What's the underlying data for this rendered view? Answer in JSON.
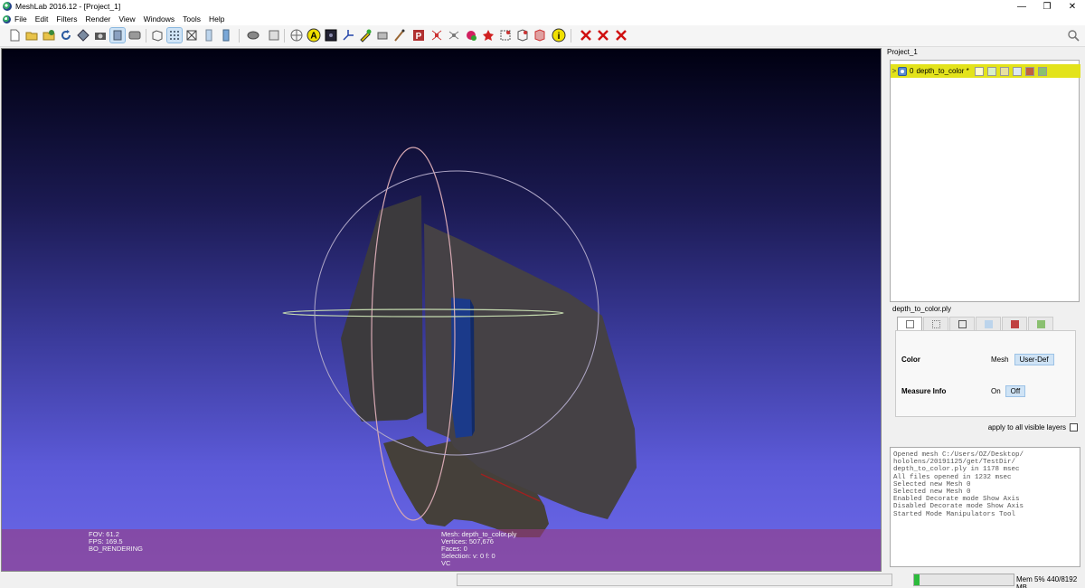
{
  "window": {
    "title": "MeshLab 2016.12 - [Project_1]",
    "controls": [
      "—",
      "❐",
      "✕"
    ]
  },
  "menu": [
    "File",
    "Edit",
    "Filters",
    "Render",
    "View",
    "Windows",
    "Tools",
    "Help"
  ],
  "toolbar": {
    "buttons": [
      {
        "name": "new-project-button",
        "icon": "new-document"
      },
      {
        "name": "open-project-button",
        "icon": "folder-open"
      },
      {
        "name": "import-mesh-button",
        "icon": "folder-add"
      },
      {
        "name": "reload-button",
        "icon": "reload"
      },
      {
        "name": "save-button",
        "icon": "save-diamond"
      },
      {
        "name": "snapshot-button",
        "icon": "camera"
      },
      {
        "name": "view-layers-button",
        "icon": "layers",
        "active": true
      },
      {
        "name": "raster-layers-button",
        "icon": "raster"
      },
      {
        "name": "bbox-render-button",
        "icon": "bounding-box"
      },
      {
        "name": "points-render-button",
        "icon": "points",
        "active": true
      },
      {
        "name": "wireframe-render-button",
        "icon": "wireframe"
      },
      {
        "name": "flat-render-button",
        "icon": "flat"
      },
      {
        "name": "smooth-render-button",
        "icon": "smooth"
      },
      {
        "name": "lighting-button",
        "icon": "light"
      },
      {
        "name": "trackball-button",
        "icon": "trackball"
      },
      {
        "name": "annotation-button",
        "icon": "A"
      },
      {
        "name": "info-tool-button",
        "icon": "info-dark"
      },
      {
        "name": "axis-button",
        "icon": "axis"
      },
      {
        "name": "measure-button",
        "icon": "pencil"
      },
      {
        "name": "paint-button",
        "icon": "brush"
      },
      {
        "name": "pickpoints-button",
        "icon": "pick"
      },
      {
        "name": "image-align-button",
        "icon": "image"
      },
      {
        "name": "align-button",
        "icon": "align"
      },
      {
        "name": "fill-hole-button",
        "icon": "fill"
      },
      {
        "name": "color-edit-button",
        "icon": "color"
      },
      {
        "name": "georef-button",
        "icon": "georef"
      },
      {
        "name": "select-vertices-button",
        "icon": "select-v"
      },
      {
        "name": "select-faces-button",
        "icon": "select-f"
      },
      {
        "name": "select-connected-button",
        "icon": "select-c"
      },
      {
        "name": "manipulator-button",
        "icon": "manip"
      },
      {
        "name": "tool-info-button",
        "icon": "info-yellow"
      },
      {
        "name": "delete-selected-vertices-button",
        "icon": "delete-v"
      },
      {
        "name": "delete-selected-faces-button",
        "icon": "delete-f"
      },
      {
        "name": "delete-all-button",
        "icon": "delete-all"
      }
    ]
  },
  "viewport": {
    "left_info": [
      "FOV: 61.2",
      "FPS:   169.5",
      "BO_RENDERING"
    ],
    "center_info": [
      "Mesh: depth_to_color.ply",
      "Vertices: 507,676",
      "Faces: 0",
      "Selection: v: 0 f: 0",
      "VC"
    ],
    "colors": {
      "background_top": "#000011",
      "background_bottom": "#6b68e8",
      "info_band": "#963c82"
    }
  },
  "layer_panel": {
    "title": "Project_1",
    "layer": {
      "index": "0",
      "name": "depth_to_color *",
      "expander": ">"
    }
  },
  "decorator_panel": {
    "title": "depth_to_color.ply",
    "rows": [
      {
        "label": "Color",
        "value": "Mesh",
        "selected": "User-Def"
      },
      {
        "label": "Measure Info",
        "opt1": "On",
        "opt2": "Off"
      }
    ],
    "apply_label": "apply to all visible layers"
  },
  "log": [
    "Opened mesh C:/Users/OZ/Desktop/",
    "hololens/20191125/get/TestDir/",
    "depth_to_color.ply in 1178 msec",
    "All files opened in 1232 msec",
    "Selected new Mesh 0",
    "Selected new Mesh 0",
    "Enabled Decorate mode Show Axis",
    "Disabled Decorate mode Show Axis",
    "Started Mode Manipulators Tool"
  ],
  "status": {
    "memory_text": "Mem 5% 440/8192 MB",
    "memory_fraction": 0.05
  }
}
